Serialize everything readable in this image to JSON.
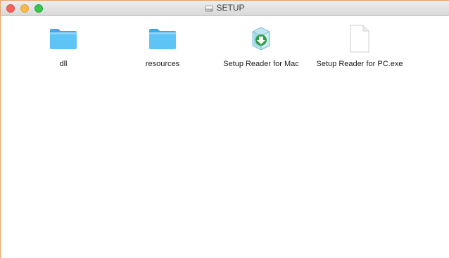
{
  "window": {
    "title": "SETUP",
    "title_icon": "disk-icon"
  },
  "files": [
    {
      "name": "dll",
      "icon": "folder-icon",
      "kind": "folder"
    },
    {
      "name": "resources",
      "icon": "folder-icon",
      "kind": "folder"
    },
    {
      "name": "Setup Reader for Mac",
      "icon": "installer-app-icon",
      "kind": "application"
    },
    {
      "name": "Setup Reader for PC.exe",
      "icon": "document-icon",
      "kind": "file"
    }
  ],
  "colors": {
    "window_border": "#e8a36a",
    "folder_blue": "#5ec3f5",
    "traffic_close": "#fc605c",
    "traffic_minimize": "#fdbc40",
    "traffic_zoom": "#34c84a"
  }
}
